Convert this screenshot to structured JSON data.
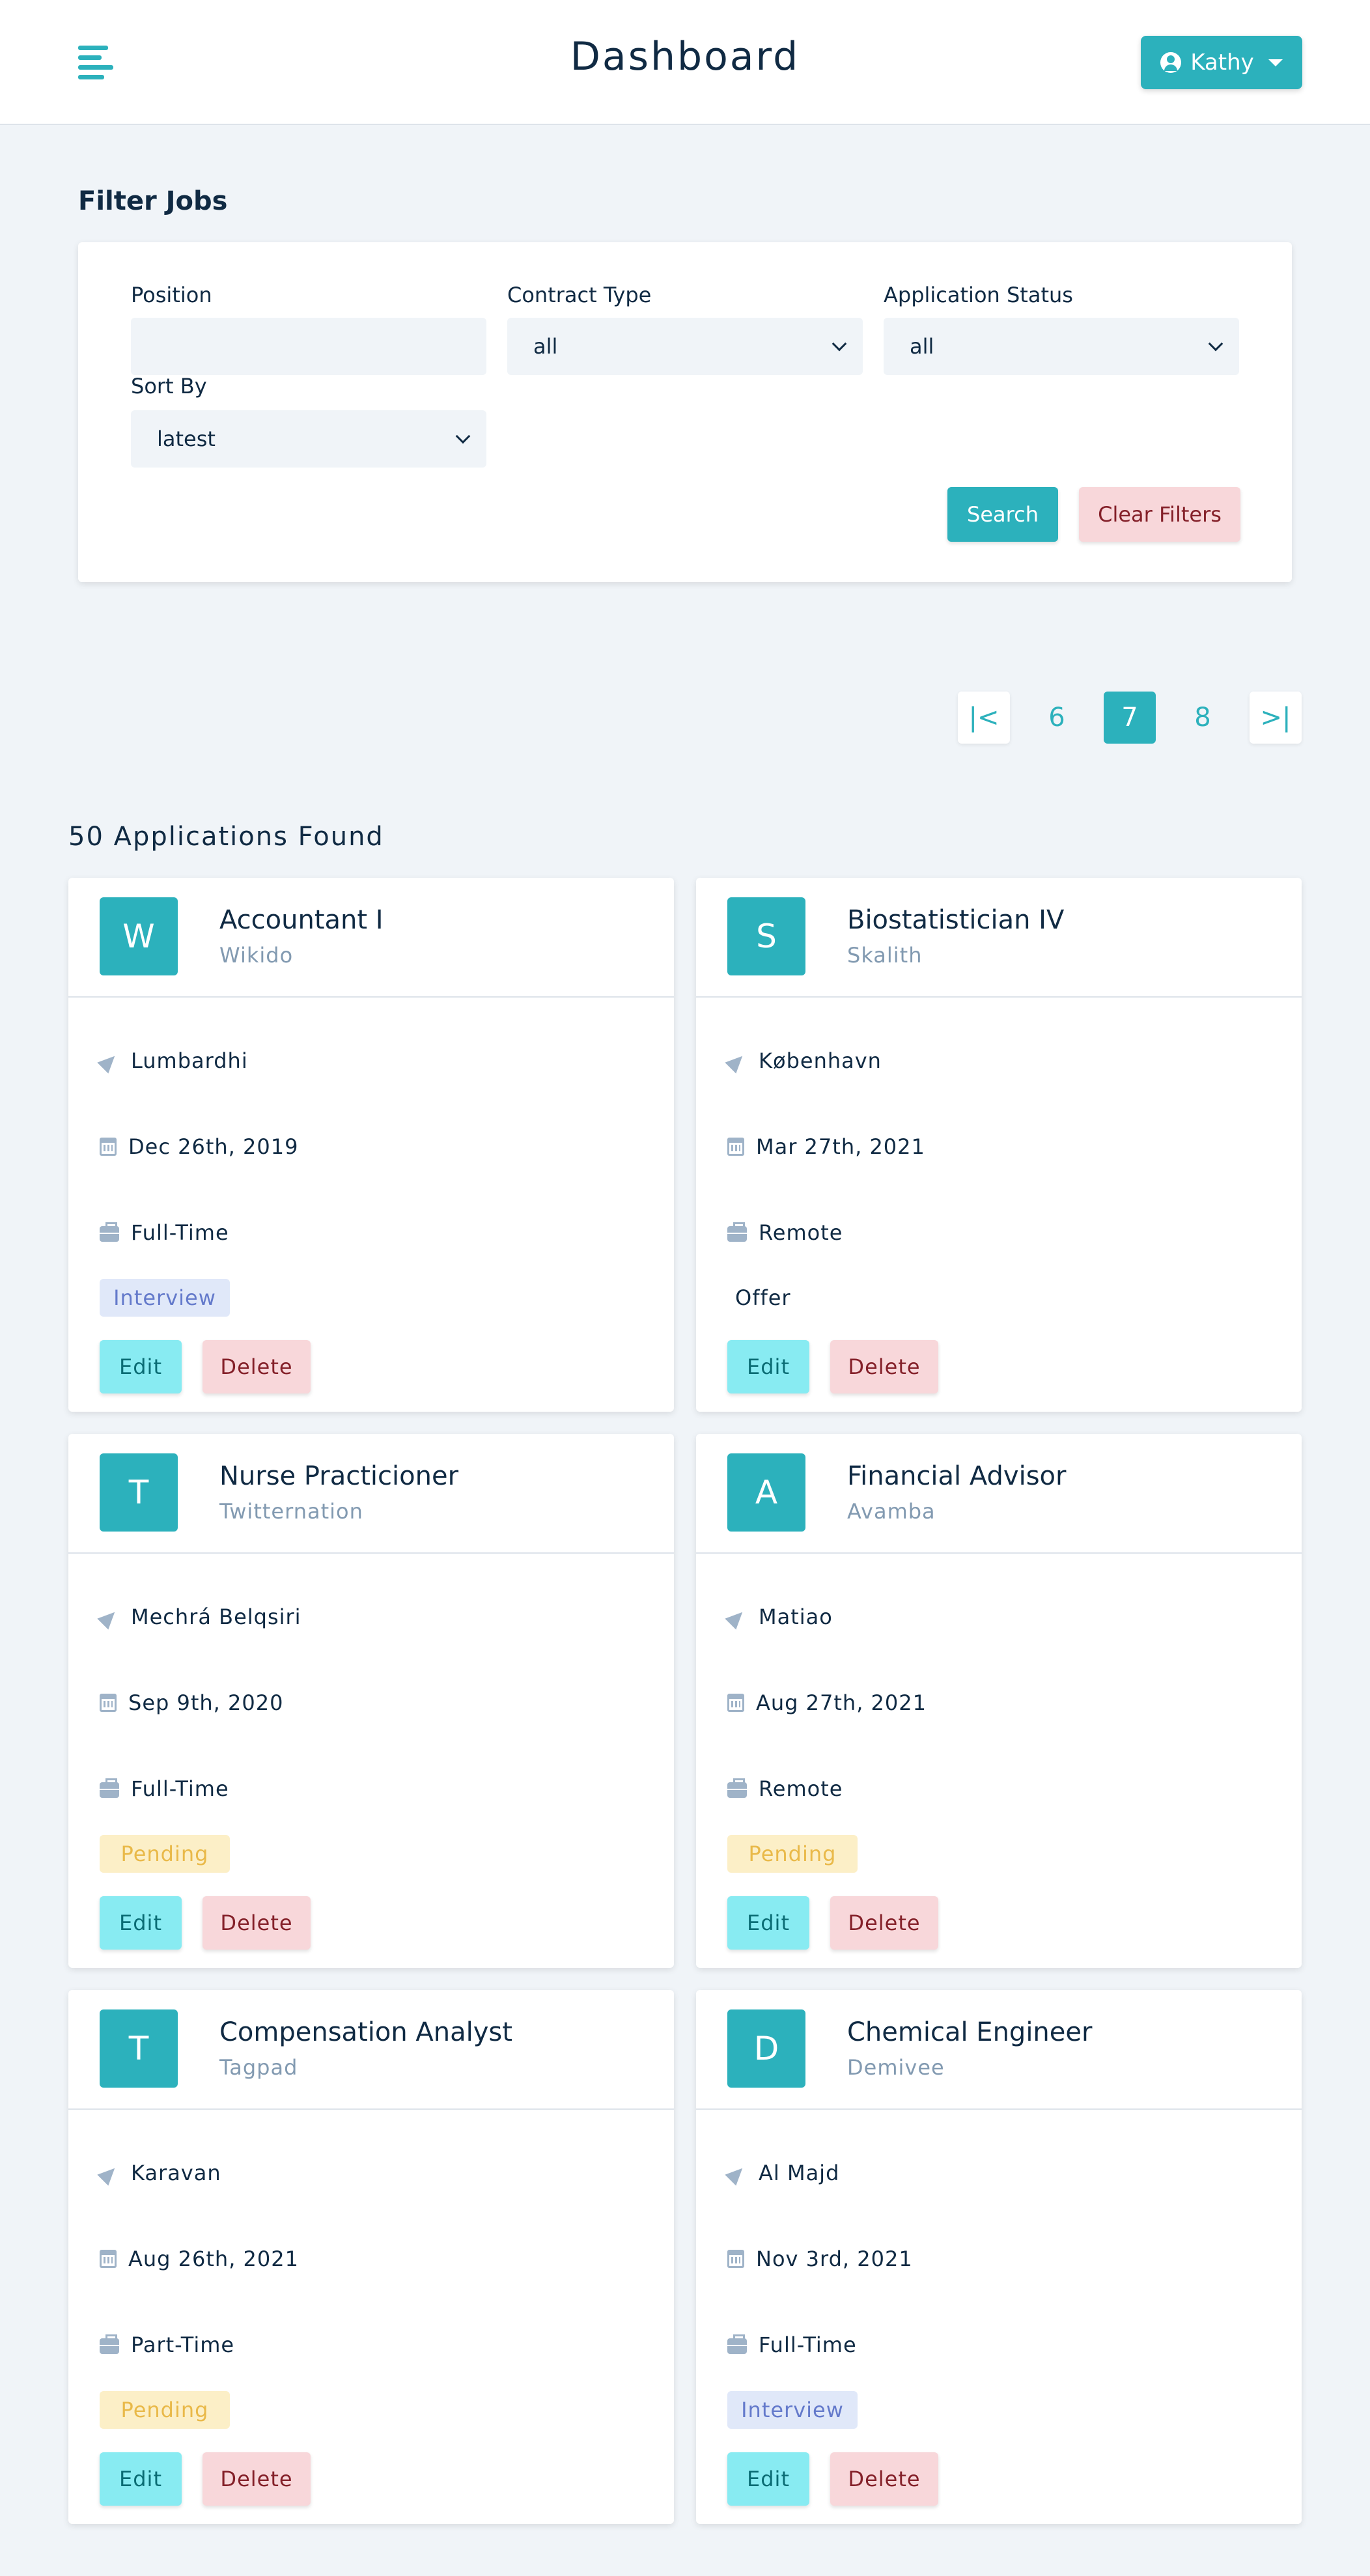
{
  "navbar": {
    "title": "Dashboard",
    "user_name": "Kathy"
  },
  "filter": {
    "heading": "Filter Jobs",
    "position_label": "Position",
    "position_value": "",
    "contract_label": "Contract Type",
    "contract_value": "all",
    "status_label": "Application Status",
    "status_value": "all",
    "sort_label": "Sort By",
    "sort_value": "latest",
    "search_label": "Search",
    "clear_label": "Clear Filters"
  },
  "pagination": {
    "first": "|<",
    "pages": [
      "6",
      "7",
      "8"
    ],
    "active": "7",
    "last": ">|"
  },
  "results": {
    "count_text": "50 Applications Found"
  },
  "jobs": [
    {
      "initial": "W",
      "position": "Accountant I",
      "company": "Wikido",
      "location": "Lumbardhi",
      "date": "Dec 26th, 2019",
      "type": "Full-Time",
      "status": "Interview"
    },
    {
      "initial": "S",
      "position": "Biostatistician IV",
      "company": "Skalith",
      "location": "København",
      "date": "Mar 27th, 2021",
      "type": "Remote",
      "status": "Offer"
    },
    {
      "initial": "T",
      "position": "Nurse Practicioner",
      "company": "Twitternation",
      "location": "Mechrá Belqsiri",
      "date": "Sep 9th, 2020",
      "type": "Full-Time",
      "status": "Pending"
    },
    {
      "initial": "A",
      "position": "Financial Advisor",
      "company": "Avamba",
      "location": "Matiao",
      "date": "Aug 27th, 2021",
      "type": "Remote",
      "status": "Pending"
    },
    {
      "initial": "T",
      "position": "Compensation Analyst",
      "company": "Tagpad",
      "location": "Karavan",
      "date": "Aug 26th, 2021",
      "type": "Part-Time",
      "status": "Pending"
    },
    {
      "initial": "D",
      "position": "Chemical Engineer",
      "company": "Demivee",
      "location": "Al Majd",
      "date": "Nov 3rd, 2021",
      "type": "Full-Time",
      "status": "Interview"
    }
  ],
  "card_actions": {
    "edit_label": "Edit",
    "delete_label": "Delete"
  },
  "colors": {
    "primary": "#2cb1bc",
    "background": "#f0f4f8",
    "interview_bg": "#e0e8f9",
    "pending_bg": "#fcefc7",
    "danger_bg": "#f8d7da"
  }
}
